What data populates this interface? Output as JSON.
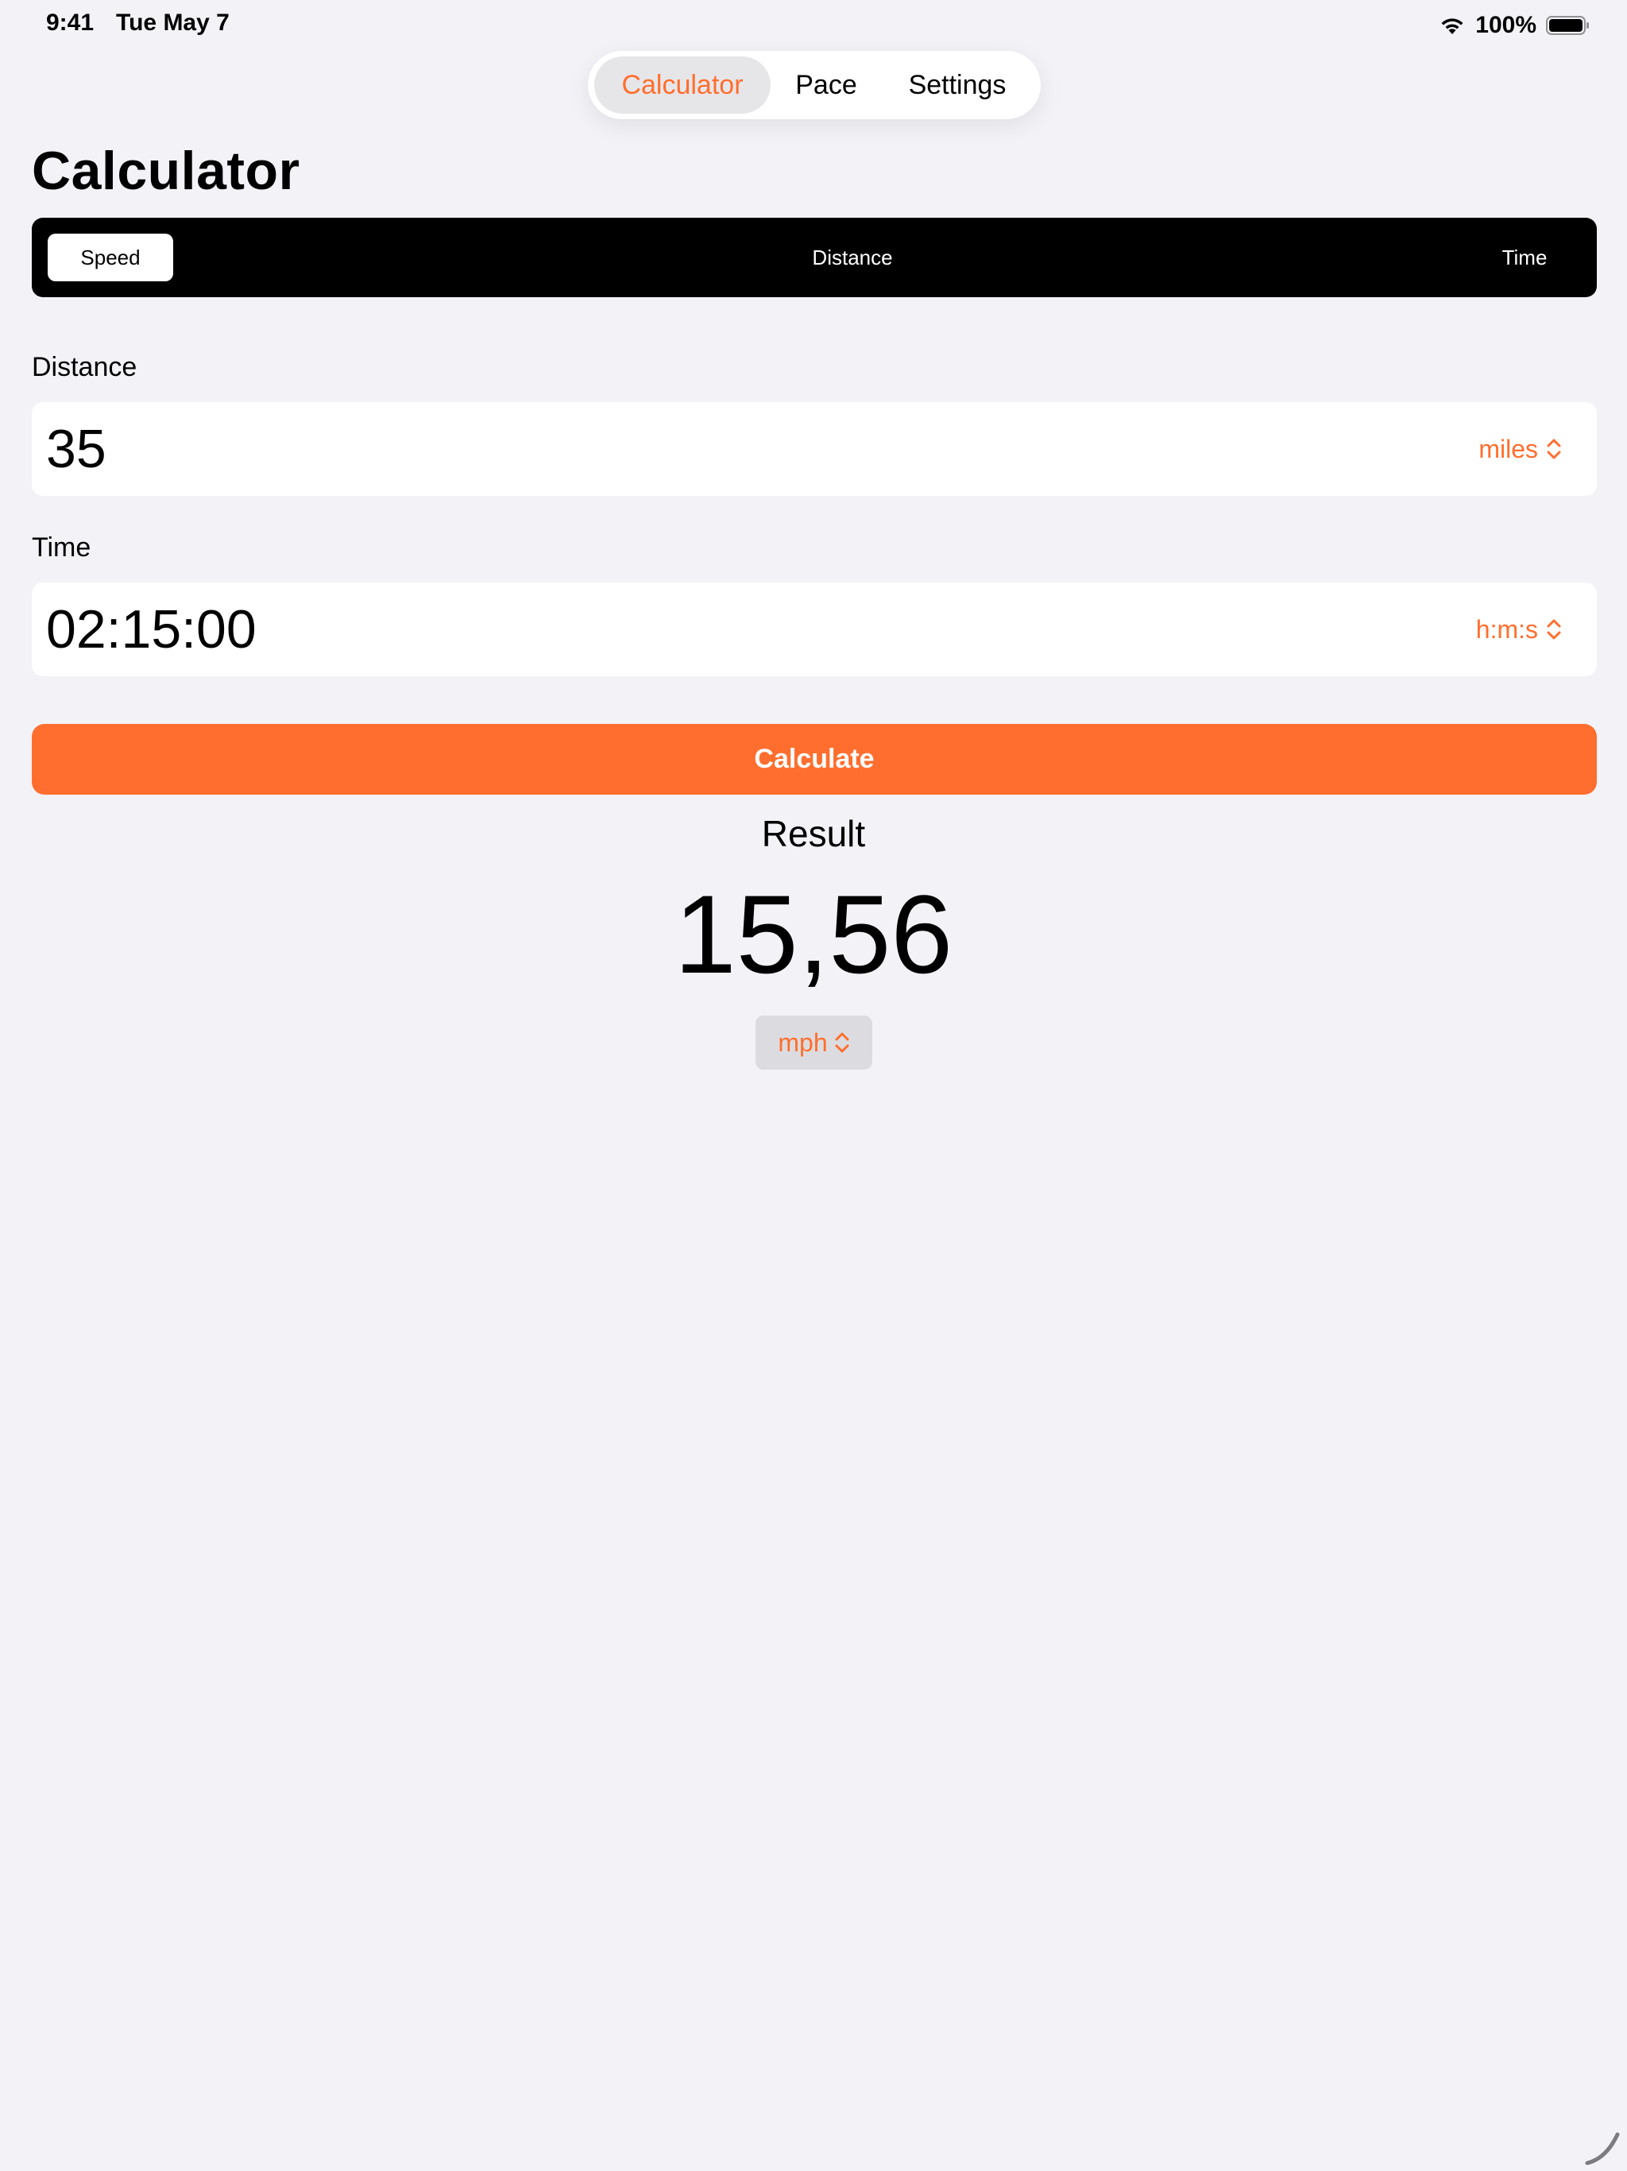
{
  "status_bar": {
    "time": "9:41",
    "date": "Tue May 7",
    "battery": "100%"
  },
  "tabs": [
    {
      "label": "Calculator",
      "active": true
    },
    {
      "label": "Pace",
      "active": false
    },
    {
      "label": "Settings",
      "active": false
    }
  ],
  "page_title": "Calculator",
  "segments": {
    "selected": "Speed",
    "options": [
      "Speed",
      "Distance",
      "Time"
    ]
  },
  "distance": {
    "label": "Distance",
    "value": "35",
    "unit": "miles"
  },
  "time": {
    "label": "Time",
    "value": "02:15:00",
    "unit": "h:m:s"
  },
  "calculate_label": "Calculate",
  "result": {
    "label": "Result",
    "value": "15,56",
    "unit": "mph"
  },
  "colors": {
    "accent": "#ff6e2e",
    "background": "#f2f2f7",
    "segmented_bg": "#000000"
  },
  "icons": [
    "wifi-icon",
    "battery-icon",
    "chevrons-updown-icon"
  ]
}
